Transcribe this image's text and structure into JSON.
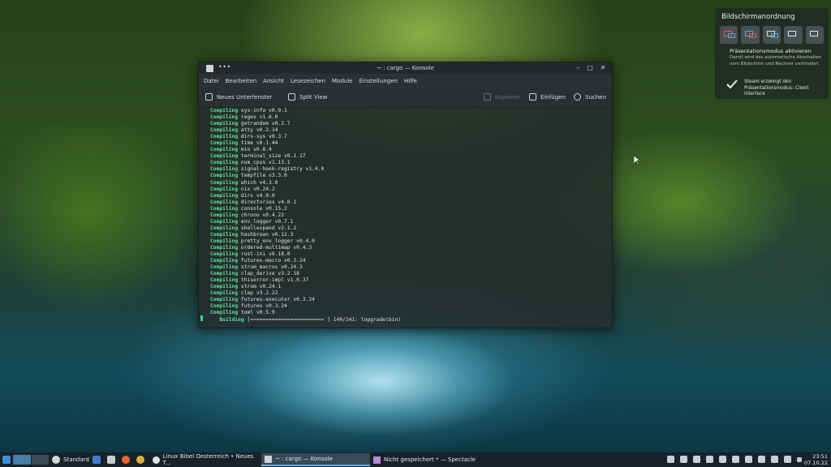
{
  "osd": {
    "title": "Bildschirmanordnung",
    "presentation_title": "Präsentationsmodus aktivieren",
    "presentation_desc": "Damit wird das automatische Abschalten vom Bildschirm und Rechner verhindert.",
    "steam_text": "Steam erzwingt den Präsentationsmodus: Client interface"
  },
  "window": {
    "title": "~ : cargo — Konsole",
    "dots": "•••",
    "menu": [
      "Datei",
      "Bearbeiten",
      "Ansicht",
      "Lesezeichen",
      "Module",
      "Einstellungen",
      "Hilfe"
    ],
    "toolbar": {
      "new_tab": "Neues Unterfenster",
      "split": "Split View",
      "copy": "Kopieren",
      "paste": "Einfügen",
      "search": "Suchen"
    }
  },
  "terminal": {
    "lines": [
      {
        "kw": "Compiling",
        "text": "sys-info v0.9.1"
      },
      {
        "kw": "Compiling",
        "text": "regex v1.6.0"
      },
      {
        "kw": "Compiling",
        "text": "getrandom v0.2.7"
      },
      {
        "kw": "Compiling",
        "text": "atty v0.2.14"
      },
      {
        "kw": "Compiling",
        "text": "dirs-sys v0.3.7"
      },
      {
        "kw": "Compiling",
        "text": "time v0.1.44"
      },
      {
        "kw": "Compiling",
        "text": "mio v0.8.4"
      },
      {
        "kw": "Compiling",
        "text": "terminal_size v0.1.17"
      },
      {
        "kw": "Compiling",
        "text": "num_cpus v1.13.1"
      },
      {
        "kw": "Compiling",
        "text": "signal-hook-registry v1.4.0"
      },
      {
        "kw": "Compiling",
        "text": "tempfile v3.3.0"
      },
      {
        "kw": "Compiling",
        "text": "which v4.3.0"
      },
      {
        "kw": "Compiling",
        "text": "nix v0.24.2"
      },
      {
        "kw": "Compiling",
        "text": "dirs v4.0.0"
      },
      {
        "kw": "Compiling",
        "text": "directories v4.0.1"
      },
      {
        "kw": "Compiling",
        "text": "console v0.15.2"
      },
      {
        "kw": "Compiling",
        "text": "chrono v0.4.22"
      },
      {
        "kw": "Compiling",
        "text": "env_logger v0.7.1"
      },
      {
        "kw": "Compiling",
        "text": "shellexpand v2.1.2"
      },
      {
        "kw": "Compiling",
        "text": "hashbrown v0.12.3"
      },
      {
        "kw": "Compiling",
        "text": "pretty_env_logger v0.4.0"
      },
      {
        "kw": "Compiling",
        "text": "ordered-multimap v0.4.3"
      },
      {
        "kw": "Compiling",
        "text": "rust-ini v0.18.0"
      },
      {
        "kw": "Compiling",
        "text": "futures-macro v0.3.24"
      },
      {
        "kw": "Compiling",
        "text": "strum_macros v0.24.3"
      },
      {
        "kw": "Compiling",
        "text": "clap_derive v3.2.18"
      },
      {
        "kw": "Compiling",
        "text": "thiserror-impl v1.0.37"
      },
      {
        "kw": "Compiling",
        "text": "strum v0.24.1"
      },
      {
        "kw": "Compiling",
        "text": "clap v3.2.22"
      },
      {
        "kw": "Compiling",
        "text": "futures-executor v0.3.24"
      },
      {
        "kw": "Compiling",
        "text": "futures v0.3.24"
      },
      {
        "kw": "Compiling",
        "text": "toml v0.5.9"
      },
      {
        "kw": "   Building",
        "text": "[=======================> ] 140/141: topgrade(bin)"
      }
    ]
  },
  "taskbar": {
    "standard": "Standard",
    "tasks": [
      {
        "label": "Linux Bibel Oesterreich • Neues T...",
        "active": false
      },
      {
        "label": "~ : cargo — Konsole",
        "active": true
      },
      {
        "label": "Nicht gespeichert * — Spectacle",
        "active": false
      }
    ],
    "time": "23:51",
    "date": "07.10.22"
  }
}
